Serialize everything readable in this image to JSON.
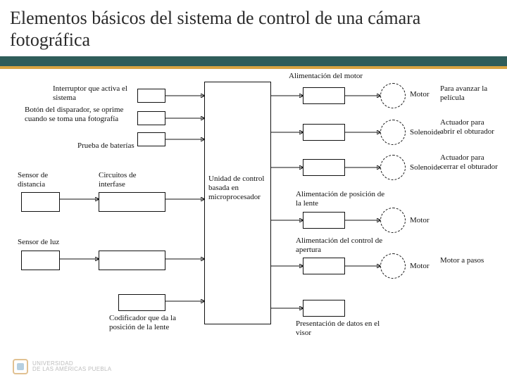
{
  "title": "Elementos básicos del sistema de control de una cámara fotográfica",
  "labels": {
    "interruptor": "Interruptor que activa el sistema",
    "boton": "Botón del disparador, se oprime cuando se toma una fotografía",
    "prueba_bat": "Prueba de baterías",
    "sensor_dist": "Sensor de distancia",
    "circuitos": "Circuitos de interfase",
    "sensor_luz": "Sensor de luz",
    "codificador": "Codificador que da la posición de la lente",
    "ucentral": "Unidad de control basada en microprocesador",
    "alim_motor": "Alimentación del motor",
    "motor": "Motor",
    "avanzar": "Para avanzar la película",
    "solenoide1": "Solenoide",
    "abrir_obturador": "Actuador para abrir el obturador",
    "solenoide2": "Solenoide",
    "cerrar_obturador": "Actuador para cerrar el obturador",
    "alim_pos_lente": "Alimentación de posición de la lente",
    "motor2": "Motor",
    "alim_apertura": "Alimentación del control de apertura",
    "motor3": "Motor",
    "motor_pasos": "Motor a pasos",
    "presentacion": "Presentación de datos en el visor"
  },
  "footer": {
    "line1": "UNIVERSIDAD",
    "line2": "DE LAS AMÉRICAS PUEBLA"
  }
}
